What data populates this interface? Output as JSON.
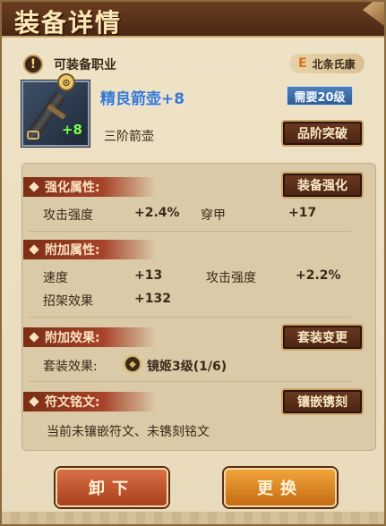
{
  "window": {
    "title": "装备详情"
  },
  "class_row": {
    "label": "可装备职业",
    "grade": "E",
    "character": "北条氏康"
  },
  "item": {
    "name": "精良箭壶+8",
    "level_req": "需要20级",
    "enhance": "+8",
    "tier": "三阶箭壶",
    "upgrade_btn": "品阶突破"
  },
  "enhance_section": {
    "title": "强化属性:",
    "button": "装备强化",
    "stats": [
      {
        "label": "攻击强度",
        "value": "+2.4%"
      },
      {
        "label": "穿甲",
        "value": "+17"
      }
    ]
  },
  "extra_section": {
    "title": "附加属性:",
    "stats": [
      {
        "label": "速度",
        "value": "+13"
      },
      {
        "label": "攻击强度",
        "value": "+2.2%"
      },
      {
        "label": "招架效果",
        "value": "+132"
      }
    ]
  },
  "effect_section": {
    "title": "附加效果:",
    "button": "套装变更",
    "set_label": "套装效果:",
    "set_value": "镜姬3级(1/6)"
  },
  "rune_section": {
    "title": "符文铭文:",
    "button": "镶嵌镌刻",
    "desc": "当前未镶嵌符文、未镌刻铭文"
  },
  "actions": {
    "unequip": "卸下",
    "replace": "更换"
  }
}
